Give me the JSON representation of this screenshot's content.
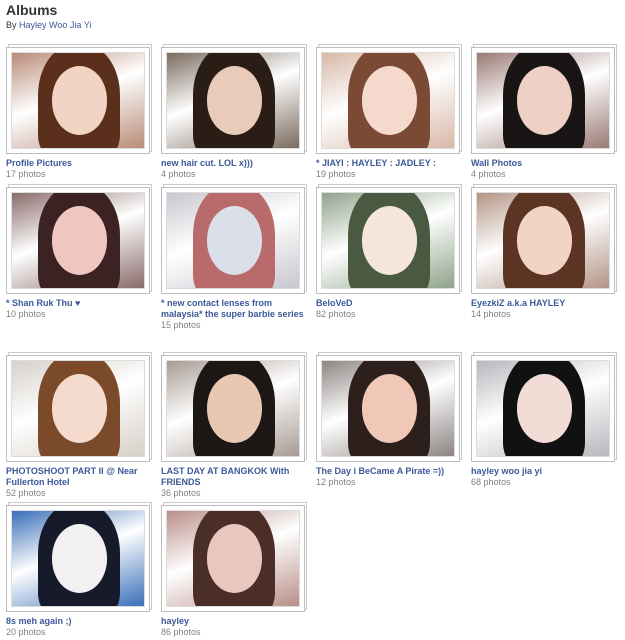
{
  "header": {
    "title": "Albums",
    "by_label": "By",
    "owner": "Hayley Woo Jia Yi"
  },
  "albums": [
    {
      "title": "Profile Pictures",
      "count": "17 photos",
      "bg": "#b98b78",
      "hair": "#5a2f1c",
      "face": "#f3d3c3"
    },
    {
      "title": "new hair cut. LOL x)))",
      "count": "4 photos",
      "bg": "#7a6b5e",
      "hair": "#2a1d16",
      "face": "#e8cbb8"
    },
    {
      "title": "* JIAYI : HAYLEY : JADLEY :",
      "count": "19 photos",
      "bg": "#d8b8a8",
      "hair": "#7a4a35",
      "face": "#f4d9cc"
    },
    {
      "title": "Wall Photos",
      "count": "4 photos",
      "bg": "#9a7a74",
      "hair": "#1a1515",
      "face": "#eed0c4"
    },
    {
      "title": "* Shan Ruk Thu ♥",
      "count": "10 photos",
      "bg": "#8a6b6b",
      "hair": "#3a2322",
      "face": "#f0c6c0"
    },
    {
      "title": "* new contact lenses from malaysia* the super barbie series",
      "count": "15 photos",
      "bg": "#c8c7cf",
      "hair": "#b96a6a",
      "face": "#dadfe9"
    },
    {
      "title": "BeloVeD",
      "count": "82 photos",
      "bg": "#8fa38a",
      "hair": "#4a5a40",
      "face": "#f5e6dd"
    },
    {
      "title": "EyezkiZ a.k.a HAYLEY",
      "count": "14 photos",
      "bg": "#b39586",
      "hair": "#5b3424",
      "face": "#f1d4c6"
    },
    {
      "title": "PHOTOSHOOT PART II @ Near Fullerton Hotel",
      "count": "52 photos",
      "bg": "#d6d0c8",
      "hair": "#7b4a2a",
      "face": "#f4dbcd"
    },
    {
      "title": "LAST DAY AT BANGKOK With FRIENDS",
      "count": "36 photos",
      "bg": "#a89c94",
      "hair": "#1c1715",
      "face": "#e8c7b3"
    },
    {
      "title": "The Day i BeCame A Pirate =))",
      "count": "12 photos",
      "bg": "#8d8583",
      "hair": "#2c1f1c",
      "face": "#efc8b8"
    },
    {
      "title": "hayley woo jia yi",
      "count": "68 photos",
      "bg": "#b9b6bc",
      "hair": "#111111",
      "face": "#f1ddd6"
    },
    {
      "title": "8s meh again ;)",
      "count": "20 photos",
      "bg": "#3a6fb8",
      "hair": "#161a2a",
      "face": "#f3f0f2"
    },
    {
      "title": "hayley",
      "count": "86 photos",
      "bg": "#b98f88",
      "hair": "#4b2e27",
      "face": "#eac7be"
    }
  ]
}
